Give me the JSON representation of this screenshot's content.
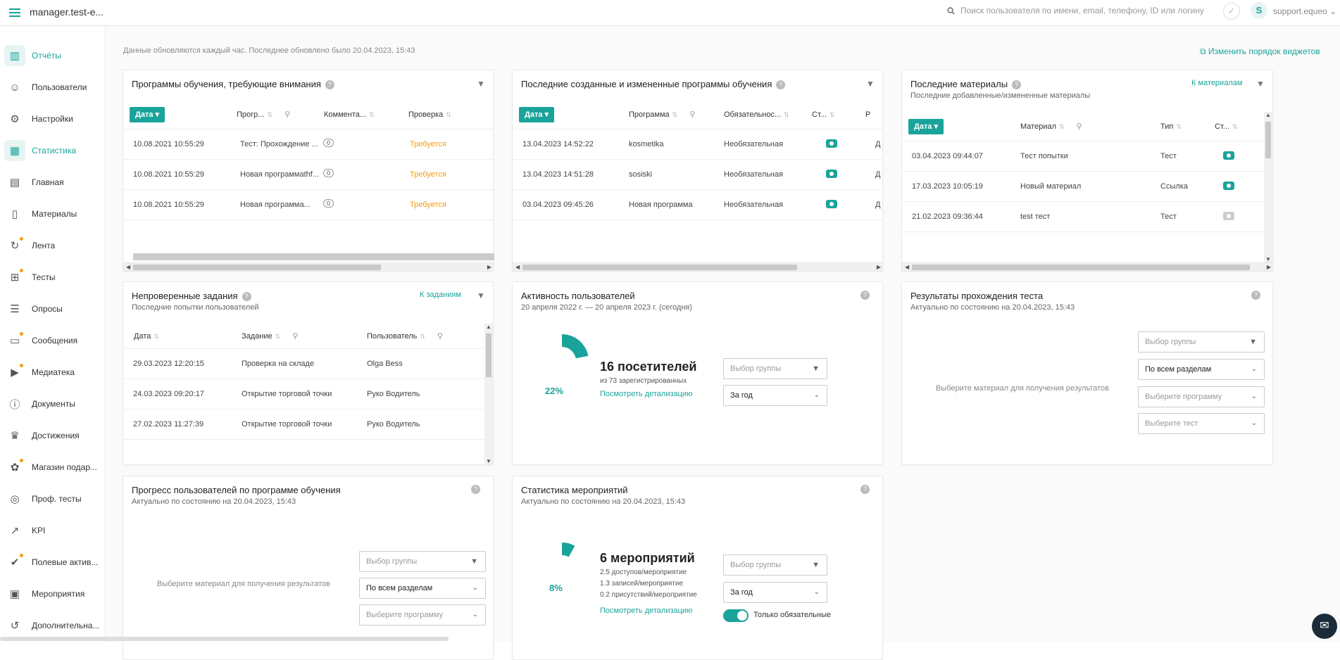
{
  "header": {
    "app_title": "manager.test-e...",
    "search_placeholder": "Поиск пользователя по имени, email, телефону, ID или логину",
    "user": "support.equeo",
    "avatar_letter": "S"
  },
  "sidebar": {
    "items": [
      {
        "label": "Отчёты",
        "icon": "chart-bars-icon",
        "active": true,
        "dot": false
      },
      {
        "label": "Пользователи",
        "icon": "users-icon",
        "active": false,
        "dot": false
      },
      {
        "label": "Настройки",
        "icon": "gear-icon",
        "active": false,
        "dot": false
      },
      {
        "label": "Статистика",
        "icon": "stats-icon",
        "active": true,
        "dot": false
      },
      {
        "label": "Главная",
        "icon": "grid-icon",
        "active": false,
        "dot": false
      },
      {
        "label": "Материалы",
        "icon": "file-icon",
        "active": false,
        "dot": false
      },
      {
        "label": "Лента",
        "icon": "feed-icon",
        "active": false,
        "dot": true
      },
      {
        "label": "Тесты",
        "icon": "tests-icon",
        "active": false,
        "dot": true
      },
      {
        "label": "Опросы",
        "icon": "survey-icon",
        "active": false,
        "dot": false
      },
      {
        "label": "Сообщения",
        "icon": "message-icon",
        "active": false,
        "dot": true
      },
      {
        "label": "Медиатека",
        "icon": "media-icon",
        "active": false,
        "dot": true
      },
      {
        "label": "Документы",
        "icon": "document-icon",
        "active": false,
        "dot": false
      },
      {
        "label": "Достижения",
        "icon": "trophy-icon",
        "active": false,
        "dot": false
      },
      {
        "label": "Магазин подар...",
        "icon": "gift-icon",
        "active": false,
        "dot": true
      },
      {
        "label": "Проф. тесты",
        "icon": "target-icon",
        "active": false,
        "dot": false
      },
      {
        "label": "KPI",
        "icon": "kpi-icon",
        "active": false,
        "dot": false
      },
      {
        "label": "Полевые актив...",
        "icon": "check-icon",
        "active": false,
        "dot": true
      },
      {
        "label": "Мероприятия",
        "icon": "calendar-icon",
        "active": false,
        "dot": false
      },
      {
        "label": "Дополнительна...",
        "icon": "extra-icon",
        "active": false,
        "dot": false
      }
    ]
  },
  "main": {
    "update_info": "Данные обновляются каждый час. Последнее обновлено было 20.04.2023, 15:43",
    "reorder_label": "Изменить порядок виджетов"
  },
  "w1": {
    "title": "Программы обучения, требующие внимания",
    "cols": [
      "Дата",
      "Прогр...",
      "Коммента...",
      "Проверка"
    ],
    "rows": [
      [
        "10.08.2021 10:55:29",
        "Тест: Прохождение ...",
        "0",
        "Требуется"
      ],
      [
        "10.08.2021 10:55:29",
        "Новая программаthf...",
        "0",
        "Требуется"
      ],
      [
        "10.08.2021 10:55:29",
        "Новая программа...",
        "0",
        "Требуется"
      ]
    ]
  },
  "w2": {
    "title": "Последние созданные и измененные программы обучения",
    "cols": [
      "Дата",
      "Программа",
      "Обязательнос...",
      "Ст...",
      "Р"
    ],
    "rows": [
      [
        "13.04.2023 14:52:22",
        "kosmetika",
        "Необязательная",
        "Д"
      ],
      [
        "13.04.2023 14:51:28",
        "sosiski",
        "Необязательная",
        "Д"
      ],
      [
        "03.04.2023 09:45:26",
        "Новая программа",
        "Необязательная",
        "Д"
      ]
    ]
  },
  "w3": {
    "title": "Последние материалы",
    "subtitle": "Последние добавленные/измененные материалы",
    "link": "К материалам",
    "cols": [
      "Дата",
      "Материал",
      "Тип",
      "Ст..."
    ],
    "rows": [
      [
        "03.04.2023 09:44:07",
        "Тест попытки",
        "Тест"
      ],
      [
        "17.03.2023 10:05:19",
        "Новый материал",
        "Ссылка"
      ],
      [
        "21.02.2023 09:36:44",
        "test тест",
        "Тест"
      ]
    ]
  },
  "w4": {
    "title": "Непроверенные задания",
    "subtitle": "Последние попытки пользователей",
    "link": "К заданиям",
    "cols": [
      "Дата",
      "Задание",
      "Пользователь"
    ],
    "rows": [
      [
        "29.03.2023 12:20:15",
        "Проверка на складе",
        "Olga Bess"
      ],
      [
        "24.03.2023 09:20:17",
        "Открытие торговой точки",
        "Руко Водитель"
      ],
      [
        "27.02.2023 11:27:39",
        "Открытие торговой точки",
        "Руко Водитель"
      ]
    ]
  },
  "w5": {
    "title": "Активность пользователей",
    "subtitle": "20 апреля 2022 г. — 20 апреля 2023 г. (сегодня)",
    "percent": "22%",
    "percent_value": 0.22,
    "big": "16 посетителей",
    "small": "из 73 зарегистрированных",
    "link": "Посмотреть детализацию",
    "group_placeholder": "Выбор группы",
    "period": "За год"
  },
  "w6": {
    "title": "Результаты прохождения теста",
    "subtitle": "Актуально по состоянию на 20.04.2023, 15:43",
    "message": "Выберите материал для получения результатов",
    "group_placeholder": "Выбор группы",
    "sections": "По всем разделам",
    "program_placeholder": "Выберите программу",
    "test_placeholder": "Выберите тест"
  },
  "w7": {
    "title": "Прогресс пользователей по программе обучения",
    "subtitle": "Актуально по состоянию на 20.04.2023, 15:43",
    "message": "Выберите материал для получения результатов",
    "group_placeholder": "Выбор группы",
    "sections": "По всем разделам",
    "program_placeholder": "Выберите программу"
  },
  "w8": {
    "title": "Статистика мероприятий",
    "subtitle": "Актуально по состоянию на 20.04.2023, 15:43",
    "percent": "8%",
    "percent_value": 0.08,
    "big": "6 мероприятий",
    "line1": "2.5 доступов/мероприятие",
    "line2": "1.3 записей/мероприятие",
    "line3": "0.2 присутствий/мероприятие",
    "link": "Посмотреть детализацию",
    "group_placeholder": "Выбор группы",
    "period": "За год",
    "toggle_label": "Только обязательные"
  }
}
